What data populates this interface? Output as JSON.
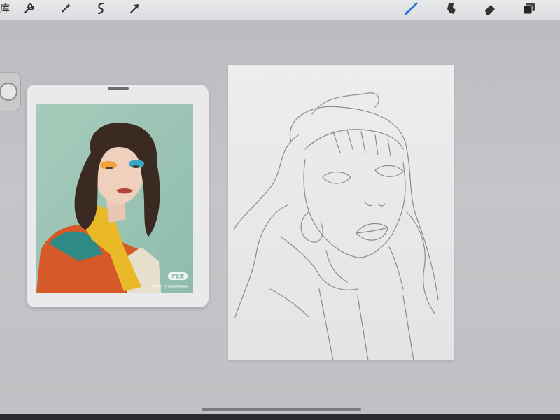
{
  "toolbar": {
    "gallery_label": "库",
    "left_tools": [
      "wrench-icon",
      "magic-wand-icon",
      "selection-icon",
      "transform-arrow-icon"
    ],
    "right_tools": [
      "brush-icon",
      "smudge-icon",
      "eraser-icon",
      "layers-icon"
    ],
    "active_tool": "brush",
    "accent_color": "#2f73d8"
  },
  "reference": {
    "badge_text": "评论数",
    "watermark": "红书号: 2039675886"
  },
  "colors": {
    "background": "#c0c2c5",
    "canvas": "#e8e8ea",
    "sketch_stroke": "#8c8c90"
  }
}
